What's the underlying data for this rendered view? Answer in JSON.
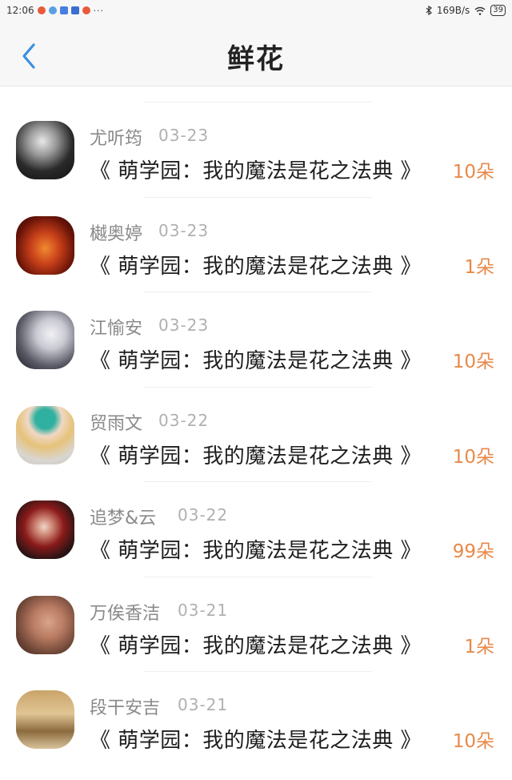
{
  "status_bar": {
    "time": "12:06",
    "net_speed": "169B/s",
    "battery": "39",
    "more": "···"
  },
  "header": {
    "title": "鲜花",
    "back_icon": "chevron-left-icon"
  },
  "colors": {
    "accent_back": "#3b8fe0",
    "amount": "#e8894a"
  },
  "items": [
    {
      "name": "尤听筠",
      "date": "03-23",
      "book": "《 萌学园：我的魔法是花之法典 》",
      "amount": "10朵"
    },
    {
      "name": "樾奥婷",
      "date": "03-23",
      "book": "《 萌学园：我的魔法是花之法典 》",
      "amount": "1朵"
    },
    {
      "name": "江愉安",
      "date": "03-23",
      "book": "《 萌学园：我的魔法是花之法典 》",
      "amount": "10朵"
    },
    {
      "name": "贸雨文",
      "date": "03-22",
      "book": "《 萌学园：我的魔法是花之法典 》",
      "amount": "10朵"
    },
    {
      "name": "追梦&云",
      "date": "03-22",
      "book": "《 萌学园：我的魔法是花之法典 》",
      "amount": "99朵"
    },
    {
      "name": "万俟香洁",
      "date": "03-21",
      "book": "《 萌学园：我的魔法是花之法典 》",
      "amount": "1朵"
    },
    {
      "name": "段干安吉",
      "date": "03-21",
      "book": "《 萌学园：我的魔法是花之法典 》",
      "amount": "10朵"
    }
  ]
}
